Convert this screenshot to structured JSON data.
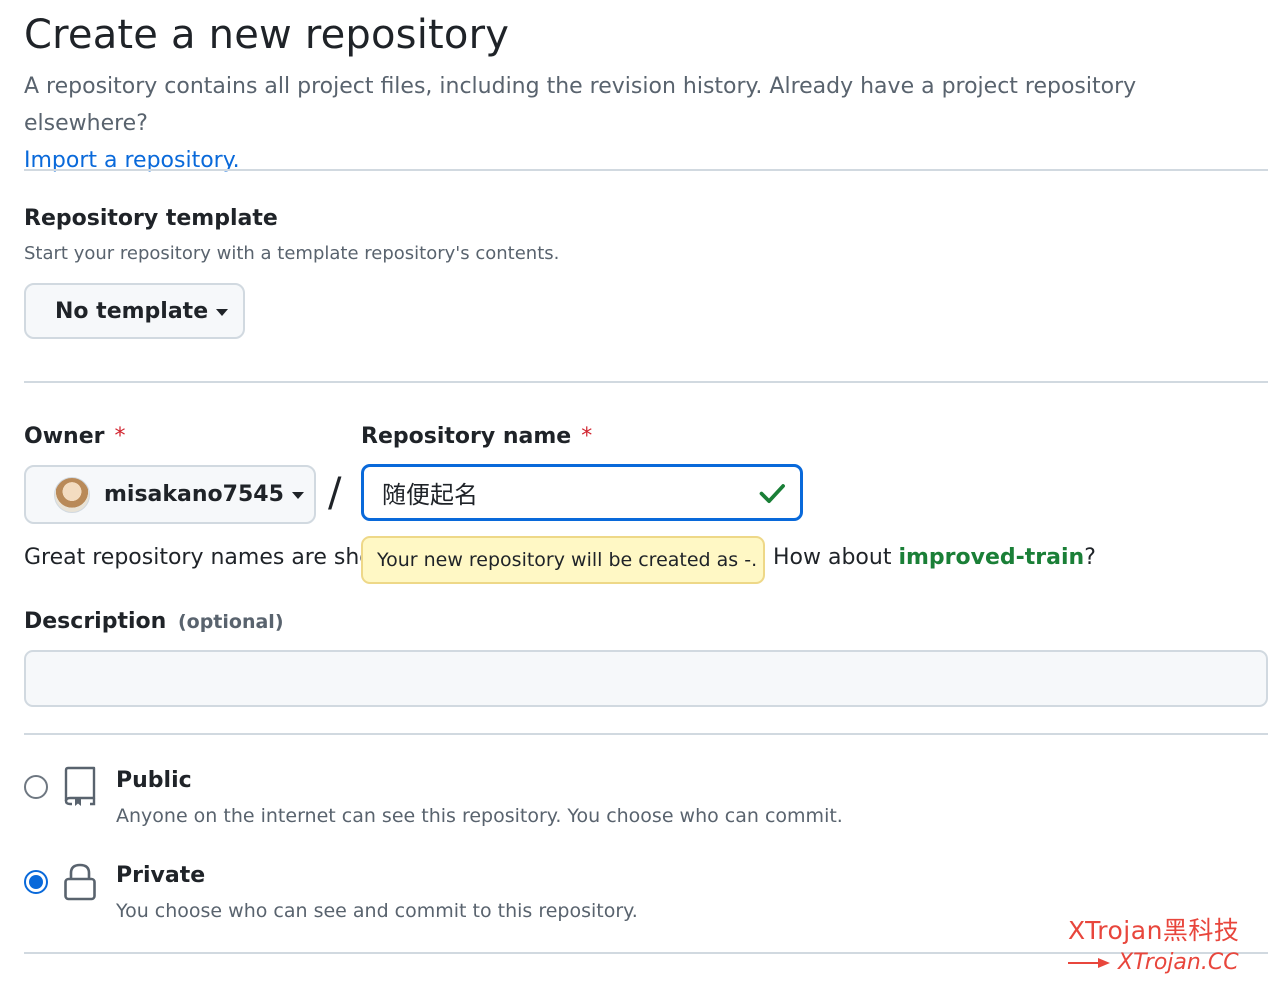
{
  "header": {
    "title": "Create a new repository",
    "subtitle": "A repository contains all project files, including the revision history. Already have a project repository elsewhere?",
    "import_link": "Import a repository."
  },
  "template": {
    "heading": "Repository template",
    "note": "Start your repository with a template repository's contents.",
    "selected": "No template"
  },
  "owner": {
    "label": "Owner",
    "required_mark": "*",
    "selected": "misakano7545"
  },
  "separator": "/",
  "repo_name": {
    "label": "Repository name",
    "required_mark": "*",
    "value": "随便起名",
    "valid": true
  },
  "name_hint": {
    "prefix": "Great repository names are sho",
    "after_tooltip": "How about ",
    "suggestion": "improved-train",
    "suffix": "?"
  },
  "tooltip": {
    "text": "Your new repository will be created as -."
  },
  "description": {
    "label": "Description",
    "optional": "(optional)",
    "value": ""
  },
  "visibility": {
    "options": [
      {
        "title": "Public",
        "note": "Anyone on the internet can see this repository. You choose who can commit.",
        "checked": false,
        "icon": "repo-icon"
      },
      {
        "title": "Private",
        "note": "You choose who can see and commit to this repository.",
        "checked": true,
        "icon": "lock-icon"
      }
    ]
  },
  "watermark": {
    "line1": "XTrojan黑科技",
    "line2": "XTrojan.CC"
  },
  "colors": {
    "link": "#0969da",
    "suggestion": "#1a7f37",
    "required": "#d1242f",
    "focus": "#0969da",
    "tooltip_bg": "#fff8c5",
    "watermark": "#e8463c"
  }
}
